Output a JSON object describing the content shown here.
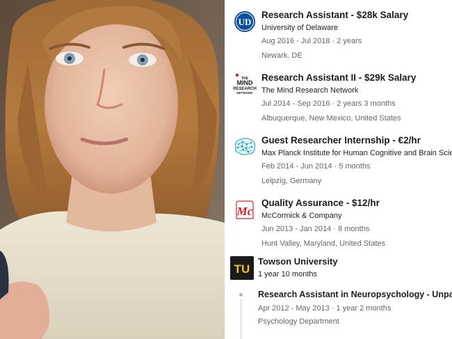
{
  "experience": [
    {
      "title": "Research Assistant - $28k Salary",
      "company": "University of Delaware",
      "dates": "Aug 2016 - Jul 2018 · 2 years",
      "location": "Newark, DE",
      "logo_icon": "ud-logo-icon",
      "logo_text": "UD"
    },
    {
      "title": "Research Assistant II - $29k Salary",
      "company": "The Mind Research Network",
      "dates": "Jul 2014 - Sep 2016 · 2 years 3 months",
      "location": "Albuquerque, New Mexico, United States",
      "logo_icon": "mind-research-logo-icon",
      "logo_lines": [
        "THE",
        "MIND",
        "RESEARCH",
        "NETWORK"
      ]
    },
    {
      "title": "Guest Researcher Internship - €2/hr",
      "company": "Max Planck Institute for Human Cognitive and Brain Sciences",
      "dates": "Feb 2014 - Jun 2014 · 5 months",
      "location": "Leipzig, Germany",
      "logo_icon": "brain-network-logo-icon"
    },
    {
      "title": "Quality Assurance - $12/hr",
      "company": "McCormick & Company",
      "dates": "Jun 2013 - Jan 2014 · 8 months",
      "location": "Hunt Valley, Maryland, United States",
      "logo_icon": "mccormick-logo-icon",
      "logo_text": "Mc"
    }
  ],
  "towson": {
    "name": "Towson University",
    "duration": "1 year 10 months",
    "logo_icon": "towson-logo-icon",
    "logo_text": "TU",
    "roles": [
      {
        "title": "Research Assistant in Neuropsychology - Unpaid",
        "dates": "Apr 2012 - May 2013 · 1 year 2 months",
        "department": "Psychology Department"
      }
    ]
  },
  "colors": {
    "ud_blue": "#0a4f9e",
    "mccormick_red": "#d8202b",
    "towson_gold": "#f5c21b",
    "towson_black": "#1a1a1a",
    "brain_teal": "#4fb7c6"
  }
}
